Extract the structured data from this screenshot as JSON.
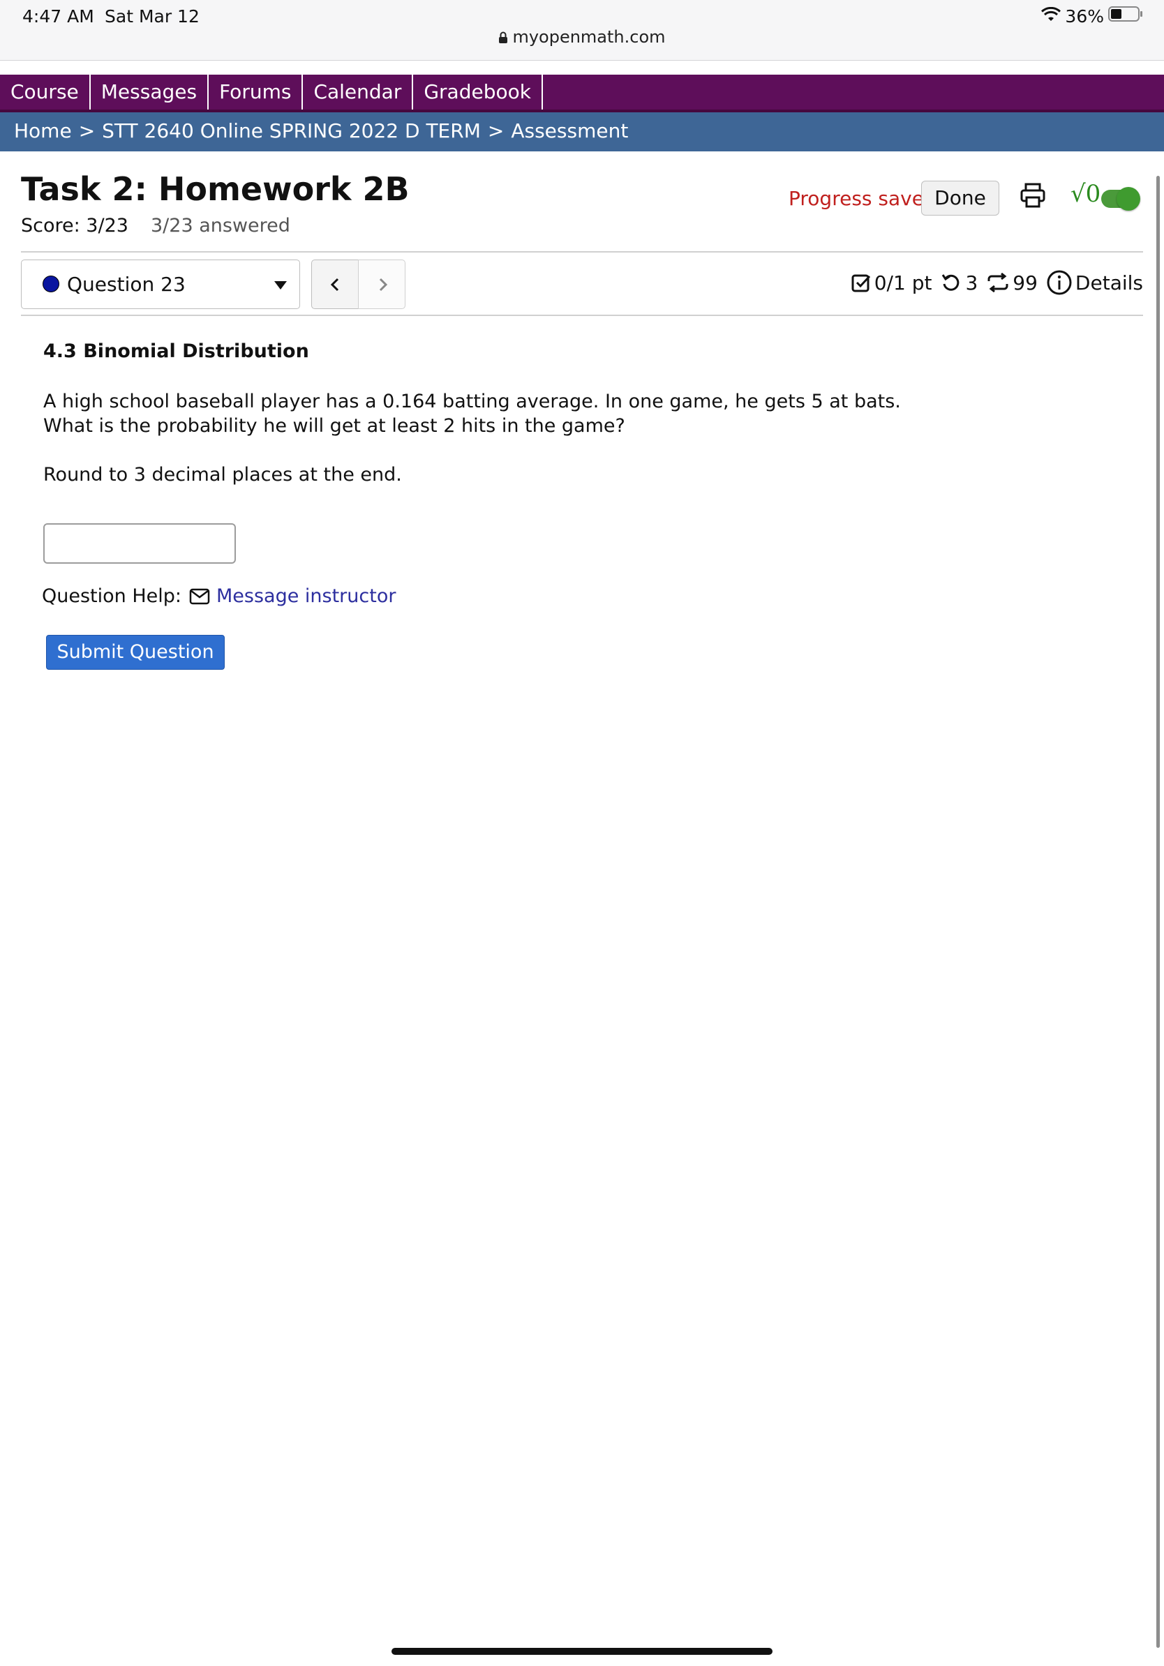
{
  "status_bar": {
    "time": "4:47 AM",
    "date": "Sat Mar 12",
    "battery": "36%",
    "url": "myopenmath.com"
  },
  "nav": {
    "items": [
      "Course",
      "Messages",
      "Forums",
      "Calendar",
      "Gradebook"
    ]
  },
  "breadcrumb": {
    "home": "Home",
    "course": "STT 2640 Online SPRING 2022 D TERM",
    "current": "Assessment",
    "separator": ">"
  },
  "header": {
    "title": "Task 2: Homework 2B",
    "score": "Score: 3/23",
    "answered": "3/23 answered",
    "progress": "Progress saved",
    "done_label": "Done",
    "math_toggle": "√0",
    "toggle_color": "#3f9b2f"
  },
  "question_nav": {
    "selected": "Question 23",
    "points": "0/1 pt",
    "retries": "3",
    "regens": "99",
    "details": "Details"
  },
  "question": {
    "heading": "4.3 Binomial Distribution",
    "text": "A high school baseball player has a 0.164 batting average. In one game, he gets 5 at bats. What is the probability he will get at least 2 hits in the game?",
    "instruction": "Round to 3 decimal places at the end.",
    "answer_value": "",
    "help_label": "Question Help:",
    "help_link": "Message instructor",
    "submit_label": "Submit Question"
  },
  "colors": {
    "nav_bg": "#5e0e5a",
    "breadcrumb_bg": "#3e6696",
    "progress_red": "#c0201e",
    "submit_blue": "#2f6fd0",
    "link": "#2d2f9f"
  }
}
